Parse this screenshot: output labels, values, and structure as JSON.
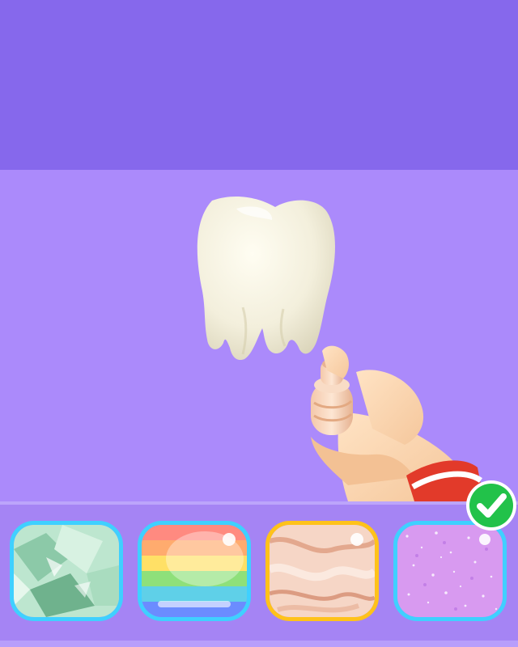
{
  "scene": {
    "background_top": "#8668ec",
    "background_stage": "#ab8afb",
    "object": "tooth",
    "tool": "spray-can-in-hand"
  },
  "skin_picker": {
    "items": [
      {
        "id": "green-marble",
        "icon": "green-marble-swatch",
        "border": "#3fd0ff",
        "selected": false
      },
      {
        "id": "rainbow",
        "icon": "rainbow-swatch",
        "border": "#3fd0ff",
        "selected": false
      },
      {
        "id": "peach-marble",
        "icon": "peach-marble-swatch",
        "border": "#ffc21a",
        "selected": false
      },
      {
        "id": "pink-glitter",
        "icon": "pink-glitter-swatch",
        "border": "#3fd0ff",
        "selected": true
      }
    ],
    "selected_indicator": {
      "icon": "checkmark-icon",
      "color": "#22c24a"
    }
  }
}
